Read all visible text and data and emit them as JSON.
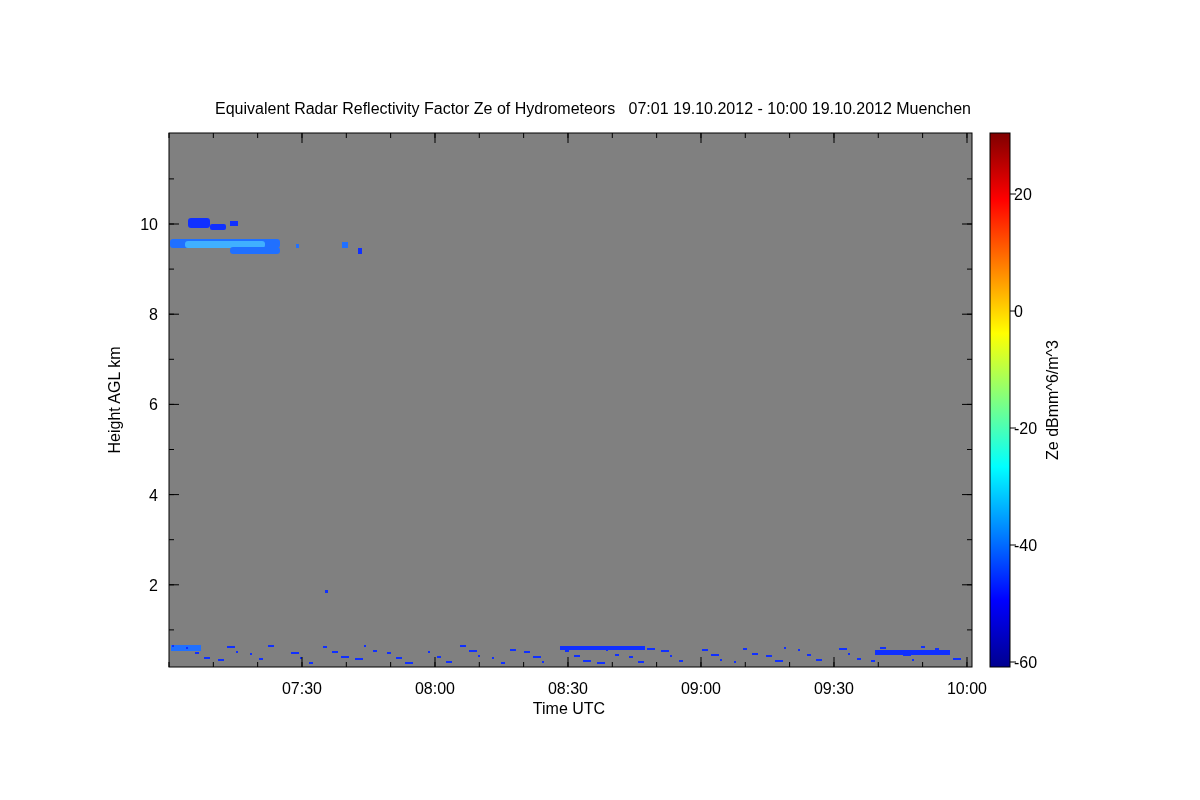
{
  "title": "Equivalent Radar Reflectivity Factor Ze of Hydrometeors   07:01 19.10.2012 - 10:00 19.10.2012 Muenchen",
  "x_axis": {
    "label": "Time UTC",
    "ticks": [
      "07:30",
      "08:00",
      "08:30",
      "09:00",
      "09:30",
      "10:00"
    ]
  },
  "y_axis": {
    "label": "Height AGL km",
    "ticks": [
      "10",
      "8",
      "6",
      "4",
      "2"
    ]
  },
  "colorbar": {
    "label": "Ze dBmm^6/m^3",
    "ticks": [
      "20",
      "0",
      "-20",
      "-40",
      "-60"
    ]
  }
}
